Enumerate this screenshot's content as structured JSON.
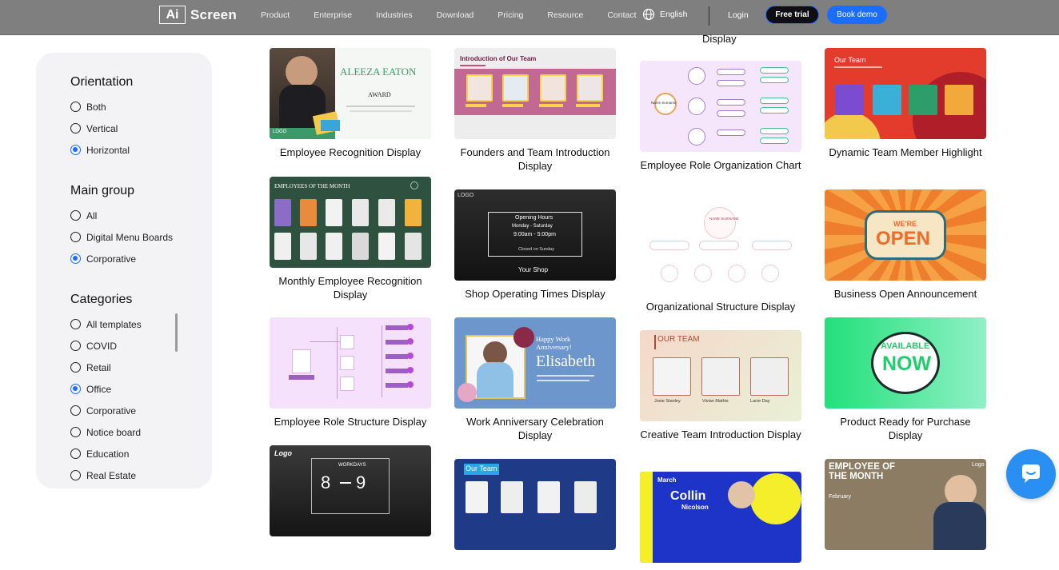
{
  "nav": {
    "logo_mark": "Ai",
    "logo_text": "Screen",
    "links": [
      "Product",
      "Enterprise",
      "Industries",
      "Download",
      "Pricing",
      "Resource",
      "Contact"
    ],
    "language": "English",
    "login": "Login",
    "free_trial": "Free trial",
    "book_demo": "Book demo"
  },
  "filters": {
    "orientation": {
      "title": "Orientation",
      "options": [
        "Both",
        "Vertical",
        "Horizontal"
      ],
      "selected": "Horizontal"
    },
    "main_group": {
      "title": "Main group",
      "options": [
        "All",
        "Digital Menu Boards",
        "Corporative"
      ],
      "selected": "Corporative"
    },
    "categories": {
      "title": "Categories",
      "options": [
        "All templates",
        "COVID",
        "Retail",
        "Office",
        "Corporative",
        "Notice board",
        "Education",
        "Real Estate"
      ],
      "selected": "Office"
    }
  },
  "cards": {
    "c1": {
      "title": "Employee Recognition Display",
      "name": "ALEEZA EATON",
      "award": "AWARD",
      "logo": "LOGO"
    },
    "c2": {
      "title": "Founders and Team Introduction Display",
      "heading": "Introduction of Our Team"
    },
    "c3": {
      "title": "Employee Role Organization Chart",
      "label": "Name Surname"
    },
    "c4": {
      "title": "Dynamic Team Member Highlight",
      "heading": "Our Team"
    },
    "c5": {
      "title": "Monthly Employee Recognition Display",
      "heading": "EMPLOYEES OF THE MONTH"
    },
    "c6": {
      "title": "Shop Operating Times Display",
      "hours_title": "Opening Hours",
      "days": "Monday - Saturday",
      "time": "9:00am - 5:00pm",
      "closed": "Closed on Sunday",
      "shop": "Your Shop",
      "logo": "LOGO"
    },
    "c7": {
      "title": "Organizational Structure Display",
      "label": "NAME SURNAME"
    },
    "c8": {
      "title": "Business Open Announcement",
      "were": "WE'RE",
      "open": "OPEN"
    },
    "c9": {
      "title": "Employee Role Structure Display"
    },
    "c10": {
      "title": "Work Anniversary Celebration Display",
      "greeting": "Happy Work Anniversary!",
      "name": "Elisabeth"
    },
    "c11": {
      "title": "Creative Team Introduction Display",
      "heading": "OUR TEAM",
      "names": [
        "Josie Stanley",
        "Vivian Mathis",
        "Lacie Day"
      ]
    },
    "c12": {
      "title": "Product Ready for Purchase Display",
      "available": "AVAILABLE",
      "now": "NOW"
    },
    "c13": {
      "title": "",
      "logo": "Logo",
      "hours_label": "WORKDAYS",
      "from": "8",
      "to": "9"
    },
    "c14": {
      "title": "",
      "heading": "Our Team"
    },
    "c15": {
      "title": "",
      "month": "March",
      "name": "Collin",
      "surname": "Nicolson"
    },
    "c16": {
      "title": "",
      "heading": "EMPLOYEE OF THE MONTH",
      "month": "February",
      "logo": "Logo"
    },
    "partial_top": "Display"
  },
  "colors": {
    "accent": "#1a6dff",
    "chat": "#2a8ff2"
  }
}
